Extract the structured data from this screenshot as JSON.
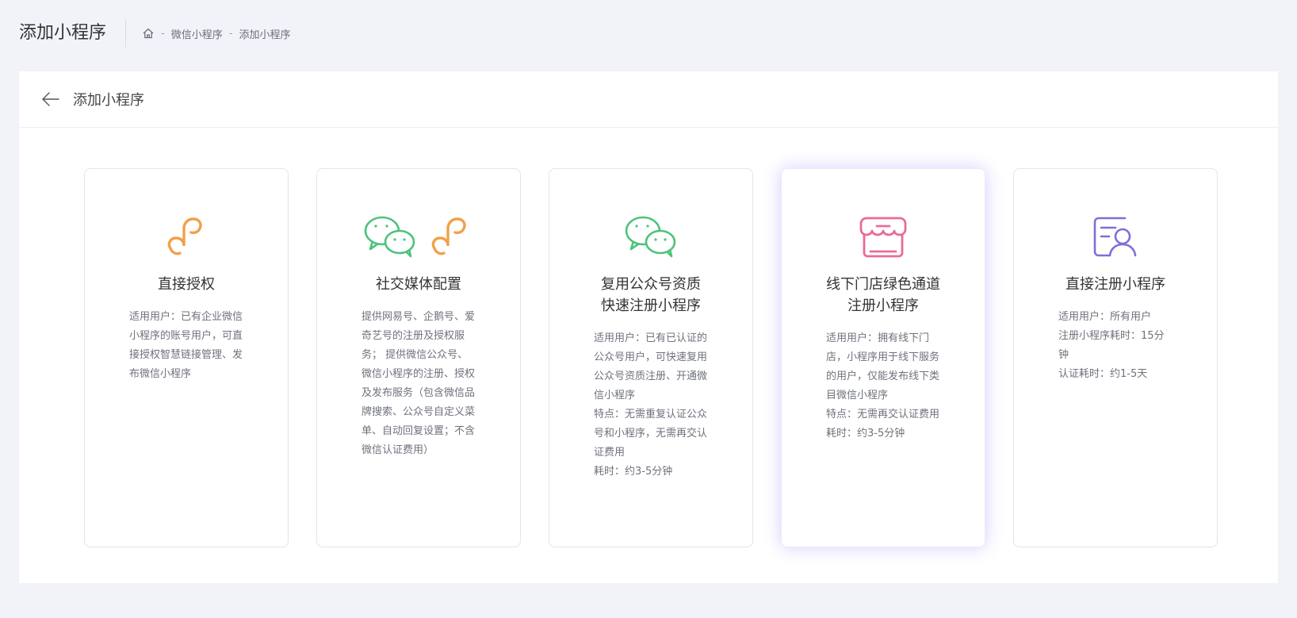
{
  "header": {
    "title": "添加小程序",
    "breadcrumb": [
      "微信小程序",
      "添加小程序"
    ],
    "separator": "-"
  },
  "panel": {
    "title": "添加小程序"
  },
  "cards": [
    {
      "id": "direct-auth",
      "icon": "mini-program-icon",
      "title": "直接授权",
      "desc": "适用用户：已有企业微信小程序的账号用户，可直接授权智慧链接管理、发布微信小程序"
    },
    {
      "id": "social-media",
      "icon": "wechat-mini-program-icon",
      "title": "社交媒体配置",
      "desc": "提供网易号、企鹅号、爱奇艺号的注册及授权服务； 提供微信公众号、微信小程序的注册、授权及发布服务（包含微信品牌搜索、公众号自定义菜单、自动回复设置；不含微信认证费用）"
    },
    {
      "id": "reuse-official",
      "icon": "wechat-icon",
      "title": "复用公众号资质\n快速注册小程序",
      "desc": "适用用户：已有已认证的公众号用户，可快速复用公众号资质注册、开通微信小程序\n特点：无需重复认证公众号和小程序，无需再交认证费用\n耗时：约3-5分钟"
    },
    {
      "id": "offline-store",
      "icon": "store-icon",
      "title": "线下门店绿色通道\n注册小程序",
      "desc": "适用用户：拥有线下门店，小程序用于线下服务的用户，仅能发布线下类目微信小程序\n特点：无需再交认证费用\n耗时：约3-5分钟"
    },
    {
      "id": "direct-register",
      "icon": "user-register-icon",
      "title": "直接注册小程序",
      "desc": "适用用户：所有用户\n注册小程序耗时：15分钟\n认证耗时：约1-5天"
    }
  ],
  "colors": {
    "orange": "#f0a14a",
    "green": "#4cc37a",
    "pink": "#e86b9a",
    "purple": "#7d6fd6",
    "active_glow": "#7e68ff"
  }
}
